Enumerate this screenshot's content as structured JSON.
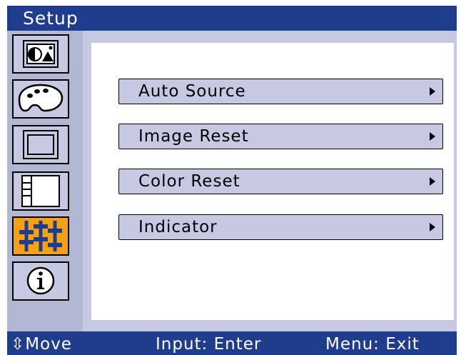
{
  "title": "Setup",
  "colors": {
    "header_bar": "#1f3d8c",
    "panel": "#c6c9e1",
    "sidebar": "#b2b7d3",
    "active_tab": "#f4a211",
    "content": "#ffffff"
  },
  "sidebar": {
    "tabs": [
      {
        "icon": "picture-icon",
        "active": false
      },
      {
        "icon": "color-palette-icon",
        "active": false
      },
      {
        "icon": "geometry-icon",
        "active": false
      },
      {
        "icon": "osd-layout-icon",
        "active": false
      },
      {
        "icon": "setup-sliders-icon",
        "active": true
      },
      {
        "icon": "info-icon",
        "active": false
      }
    ]
  },
  "menu": {
    "items": [
      {
        "label": "Auto Source"
      },
      {
        "label": "Image Reset"
      },
      {
        "label": "Color Reset"
      },
      {
        "label": "Indicator"
      }
    ]
  },
  "footer": {
    "move": "Move",
    "move_icon": "updown-arrow-icon",
    "input": "Input: Enter",
    "menu": "Menu: Exit"
  }
}
